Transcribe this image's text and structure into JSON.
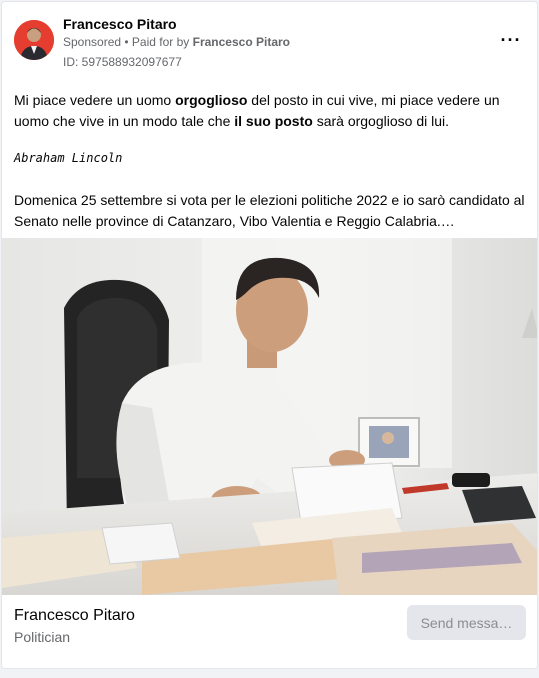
{
  "ad": {
    "page_name": "Francesco Pitaro",
    "sponsored_label": "Sponsored",
    "paid_for_prefix": " • Paid for by ",
    "paid_for_name": "Francesco Pitaro",
    "ad_id": "ID: 597588932097677",
    "more_icon": "more-options-icon"
  },
  "message": {
    "p1_a": "Mi piace vedere un uomo ",
    "p1_b": "orgoglioso",
    "p1_c": " del posto in cui vive, mi piace vedere un uomo che vive in un modo tale che ",
    "p1_d": "il suo posto",
    "p1_e": " sarà orgoglioso di lui.",
    "quote": "Abraham Lincoln",
    "p2": "Domenica 25 settembre si vota per le elezioni politiche 2022 e io sarò candidato al Senato nelle province di Catanzaro, Vibo Valentia e Reggio Calabria.…"
  },
  "footer": {
    "name": "Francesco Pitaro",
    "category": "Politician",
    "cta": "Send messa…"
  },
  "colors": {
    "avatar_bg": "#e53d2f",
    "text_primary": "#050505",
    "text_secondary": "#65676b",
    "button_bg": "#e4e6eb"
  }
}
